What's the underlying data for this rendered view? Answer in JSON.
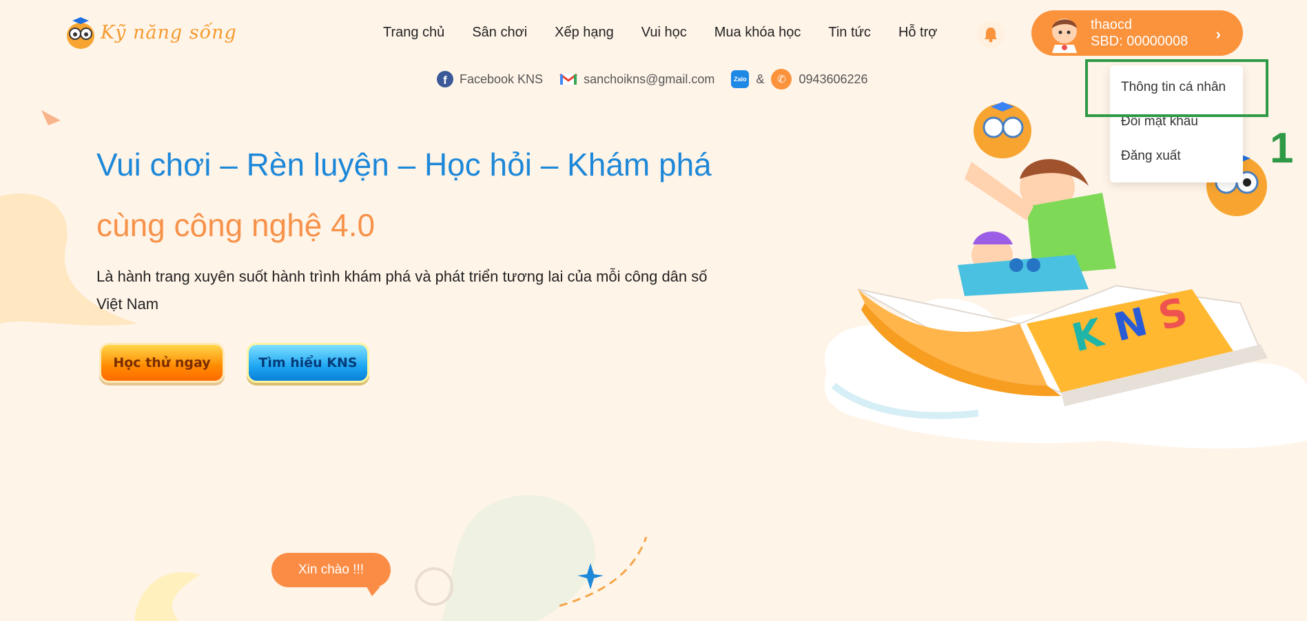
{
  "logo": {
    "text": "Kỹ năng sống"
  },
  "nav": {
    "items": [
      "Trang chủ",
      "Sân chơi",
      "Xếp hạng",
      "Vui học",
      "Mua khóa học",
      "Tin tức",
      "Hỗ trợ"
    ]
  },
  "user": {
    "name": "thaocd",
    "sbd": "SBD: 00000008"
  },
  "contacts": {
    "facebook": "Facebook KNS",
    "email": "sanchoikns@gmail.com",
    "separator": "&",
    "phone": "0943606226",
    "zalo_icon_text": "Zalo"
  },
  "dropdown": {
    "items": [
      "Thông tin cá nhân",
      "Đổi mật khẩu",
      "Đăng xuất"
    ]
  },
  "annotation": {
    "number": "1",
    "color": "#2e9946"
  },
  "hero": {
    "line1": "Vui chơi – Rèn luyện – Học hỏi – Khám phá",
    "line2": "cùng công nghệ 4.0",
    "description": "Là hành trang xuyên suốt hành trình khám phá và phát triển tương lai của mỗi công dân số Việt Nam"
  },
  "buttons": {
    "try": "Học thử ngay",
    "learn": "Tìm hiểu KNS"
  },
  "bubble": {
    "hello": "Xin chào !!!"
  },
  "book": {
    "letters": [
      "K",
      "N",
      "S"
    ]
  },
  "colors": {
    "primary_orange": "#fb923c",
    "primary_blue": "#1e88d8",
    "background": "#fff4e8"
  }
}
